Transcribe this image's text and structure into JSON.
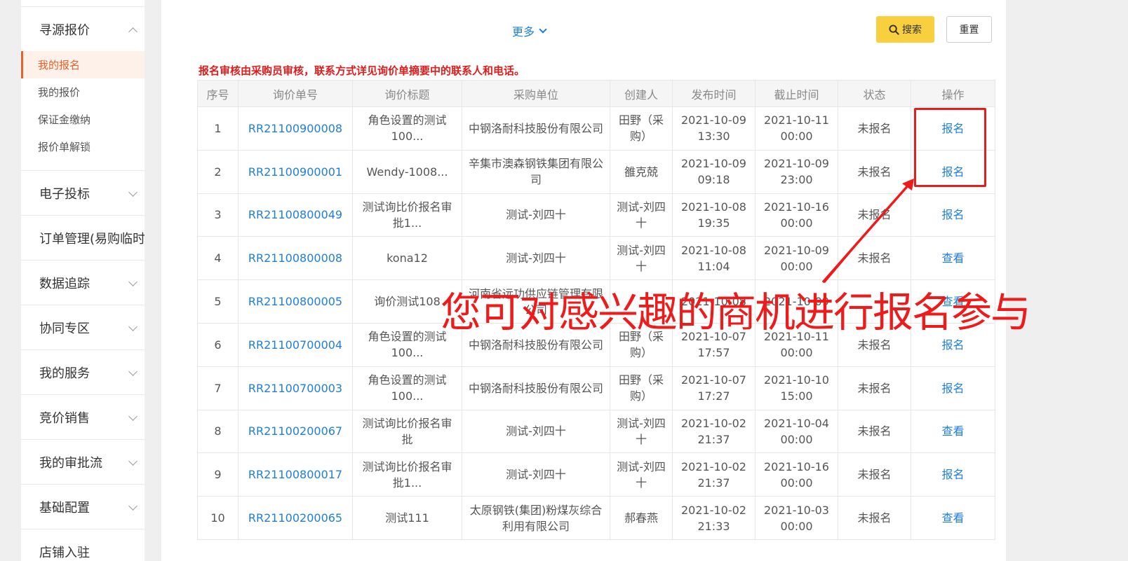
{
  "sidebar": {
    "sections": [
      {
        "label": "寻源报价",
        "expanded": true,
        "items": [
          {
            "label": "我的报名",
            "active": true
          },
          {
            "label": "我的报价",
            "active": false
          },
          {
            "label": "保证金缴纳",
            "active": false
          },
          {
            "label": "报价单解锁",
            "active": false
          }
        ]
      },
      {
        "label": "电子投标",
        "expanded": false
      },
      {
        "label": "订单管理(易购临时",
        "expanded": false
      },
      {
        "label": "数据追踪",
        "expanded": false
      },
      {
        "label": "协同专区",
        "expanded": false
      },
      {
        "label": "我的服务",
        "expanded": false
      },
      {
        "label": "竞价销售",
        "expanded": false
      },
      {
        "label": "我的审批流",
        "expanded": false
      },
      {
        "label": "基础配置",
        "expanded": false
      },
      {
        "label": "店铺入驻",
        "expanded": false
      }
    ]
  },
  "filter": {
    "more_label": "更多",
    "search_label": "搜索",
    "reset_label": "重置"
  },
  "notice": "报名审核由采购员审核，联系方式详见询价单摘要中的联系人和电话。",
  "table": {
    "headers": [
      "序号",
      "询价单号",
      "询价标题",
      "采购单位",
      "创建人",
      "发布时间",
      "截止时间",
      "状态",
      "操作"
    ],
    "rows": [
      {
        "no": "1",
        "code": "RR21100900008",
        "title": "角色设置的测试100...",
        "unit": "中钢洛耐科技股份有限公司",
        "creator": "田野（采购）",
        "publish": "2021-10-09 13:30",
        "deadline": "2021-10-11 00:00",
        "status": "未报名",
        "op": "报名"
      },
      {
        "no": "2",
        "code": "RR21100900001",
        "title": "Wendy-1008...",
        "unit": "辛集市澳森钢铁集团有限公司",
        "creator": "雒克兢",
        "publish": "2021-10-09 09:18",
        "deadline": "2021-10-09 23:00",
        "status": "未报名",
        "op": "报名"
      },
      {
        "no": "3",
        "code": "RR21100800049",
        "title": "测试询比价报名审批1...",
        "unit": "测试-刘四十",
        "creator": "测试-刘四十",
        "publish": "2021-10-08 19:35",
        "deadline": "2021-10-16 00:00",
        "status": "未报名",
        "op": "报名"
      },
      {
        "no": "4",
        "code": "RR21100800008",
        "title": "kona12",
        "unit": "测试-刘四十",
        "creator": "测试-刘四十",
        "publish": "2021-10-08 11:04",
        "deadline": "2021-10-09 00:00",
        "status": "未报名",
        "op": "查看"
      },
      {
        "no": "5",
        "code": "RR21100800005",
        "title": "询价测试108",
        "unit": "河南省远功供应链管理有限公司",
        "creator": "",
        "publish": "2021-10-08",
        "deadline": "2021-10-09",
        "status": "",
        "op": "查看"
      },
      {
        "no": "6",
        "code": "RR21100700004",
        "title": "角色设置的测试100...",
        "unit": "中钢洛耐科技股份有限公司",
        "creator": "田野（采购）",
        "publish": "2021-10-07 17:57",
        "deadline": "2021-10-11 00:00",
        "status": "未报名",
        "op": "报名"
      },
      {
        "no": "7",
        "code": "RR21100700003",
        "title": "角色设置的测试100...",
        "unit": "中钢洛耐科技股份有限公司",
        "creator": "田野（采购）",
        "publish": "2021-10-07 17:27",
        "deadline": "2021-10-10 15:00",
        "status": "未报名",
        "op": "报名"
      },
      {
        "no": "8",
        "code": "RR21100200067",
        "title": "测试询比价报名审批",
        "unit": "测试-刘四十",
        "creator": "测试-刘四十",
        "publish": "2021-10-02 21:37",
        "deadline": "2021-10-04 00:00",
        "status": "未报名",
        "op": "查看"
      },
      {
        "no": "9",
        "code": "RR21100800017",
        "title": "测试询比价报名审批1...",
        "unit": "测试-刘四十",
        "creator": "测试-刘四十",
        "publish": "2021-10-02 21:37",
        "deadline": "2021-10-16 00:00",
        "status": "未报名",
        "op": "报名"
      },
      {
        "no": "10",
        "code": "RR21100200065",
        "title": "测试111",
        "unit": "太原钢铁(集团)粉煤灰综合利用有限公司",
        "creator": "郝春燕",
        "publish": "2021-10-02 21:33",
        "deadline": "2021-10-03 00:00",
        "status": "未报名",
        "op": "查看"
      }
    ]
  },
  "annotation": {
    "text": "您可对感兴趣的商机进行报名参与",
    "color": "#ef1a1a"
  },
  "colors": {
    "link": "#1f7ed8",
    "accent": "#e8612c",
    "search_button": "#f8cf3e"
  }
}
